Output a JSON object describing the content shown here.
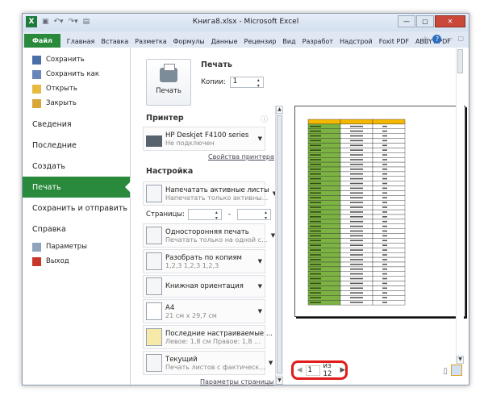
{
  "window": {
    "title": "Книга8.xlsx - Microsoft Excel",
    "minimize": "—",
    "restore": "▢",
    "close": "✕"
  },
  "ribbon": {
    "tabs": [
      "Файл",
      "Главная",
      "Вставка",
      "Разметка",
      "Формулы",
      "Данные",
      "Рецензир",
      "Вид",
      "Разработ",
      "Надстрой",
      "Foxit PDF",
      "ABBYY PDF"
    ]
  },
  "backstage": {
    "small_items": [
      {
        "label": "Сохранить",
        "icon": "save-icon"
      },
      {
        "label": "Сохранить как",
        "icon": "save-as-icon"
      },
      {
        "label": "Открыть",
        "icon": "open-folder-icon"
      },
      {
        "label": "Закрыть",
        "icon": "close-folder-icon"
      }
    ],
    "big_items": [
      "Сведения",
      "Последние",
      "Создать",
      "Печать",
      "Сохранить и отправить",
      "Справка"
    ],
    "selected": "Печать",
    "bottom_items": [
      {
        "label": "Параметры",
        "icon": "options-icon"
      },
      {
        "label": "Выход",
        "icon": "exit-icon"
      }
    ]
  },
  "print": {
    "button_label": "Печать",
    "heading": "Печать",
    "copies_label": "Копии:",
    "copies": "1",
    "printer_heading": "Принтер",
    "printer_name": "HP Deskjet F4100 series",
    "printer_status": "Не подключен",
    "printer_props": "Свойства принтера",
    "settings_heading": "Настройка",
    "pages_label": "Страницы:",
    "pages_from": "",
    "pages_to": "",
    "pages_dash": "-",
    "settings": [
      {
        "t1": "Напечатать активные листы",
        "t2": "Напечатать только активны..."
      },
      {
        "t1": "Односторонняя печать",
        "t2": "Печатать только на одной с..."
      },
      {
        "t1": "Разобрать по копиям",
        "t2": "1,2,3    1,2,3    1,2,3"
      },
      {
        "t1": "Книжная ориентация",
        "t2": ""
      },
      {
        "t1": "A4",
        "t2": "21 см x 29,7 см"
      },
      {
        "t1": "Последние настраиваемые ...",
        "t2": "Левое: 1,8 см   Правое: 1,8 ..."
      },
      {
        "t1": "Текущий",
        "t2": "Печать листов с фактическ..."
      }
    ],
    "page_setup": "Параметры страницы"
  },
  "preview": {
    "current_page": "1",
    "of_label": "из 12",
    "header_color": "#f5b800",
    "first_col_color": "#7cb342"
  }
}
